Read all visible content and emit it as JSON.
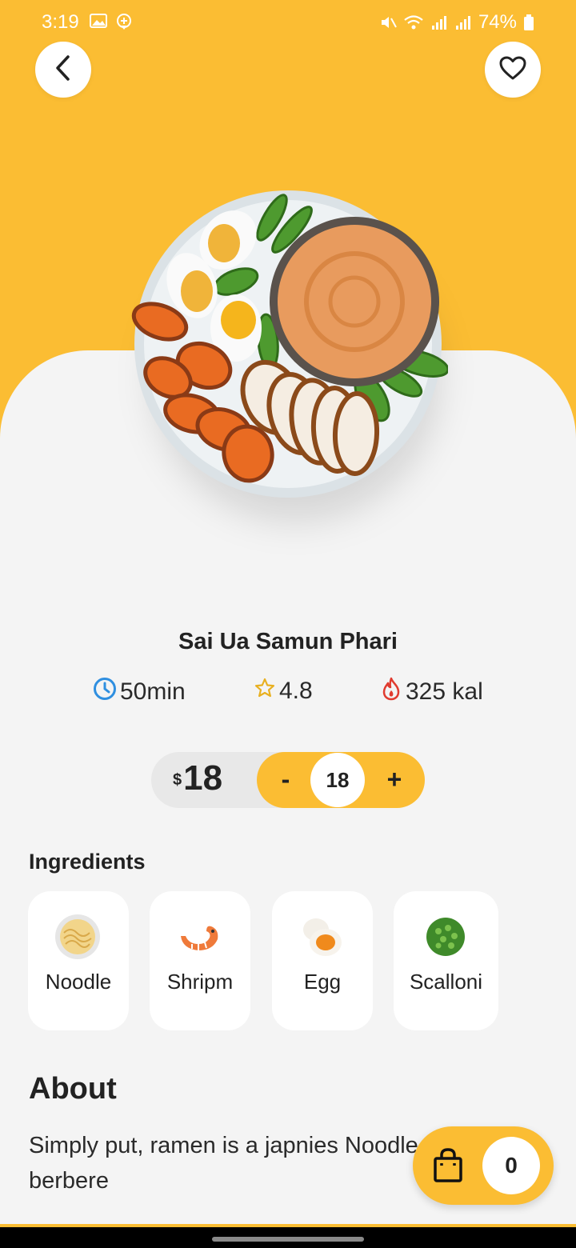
{
  "status_bar": {
    "time": "3:19",
    "battery": "74%"
  },
  "header": {
    "back_icon": "chevron-left-icon",
    "favorite_icon": "heart-outline-icon"
  },
  "dish": {
    "name": "Sai Ua Samun Phari",
    "image": "plate-of-food-image"
  },
  "stats": {
    "time": "50min",
    "rating": "4.8",
    "calories": "325 kal"
  },
  "order": {
    "currency": "$",
    "price": "18",
    "minus_label": "-",
    "quantity": "18",
    "plus_label": "+"
  },
  "ingredients": {
    "heading": "Ingredients",
    "items": [
      {
        "label": "Noodle",
        "icon": "noodle-icon"
      },
      {
        "label": "Shripm",
        "icon": "shrimp-icon"
      },
      {
        "label": "Egg",
        "icon": "egg-icon"
      },
      {
        "label": "Scalloni",
        "icon": "scallion-icon"
      }
    ]
  },
  "about": {
    "heading": "About",
    "text": "Simply put, ramen is a japnies Noodle soup,with berbere"
  },
  "cart": {
    "count": "0",
    "icon": "shopping-bag-icon"
  },
  "colors": {
    "accent": "#fbbd33",
    "background": "#f4f4f4"
  }
}
